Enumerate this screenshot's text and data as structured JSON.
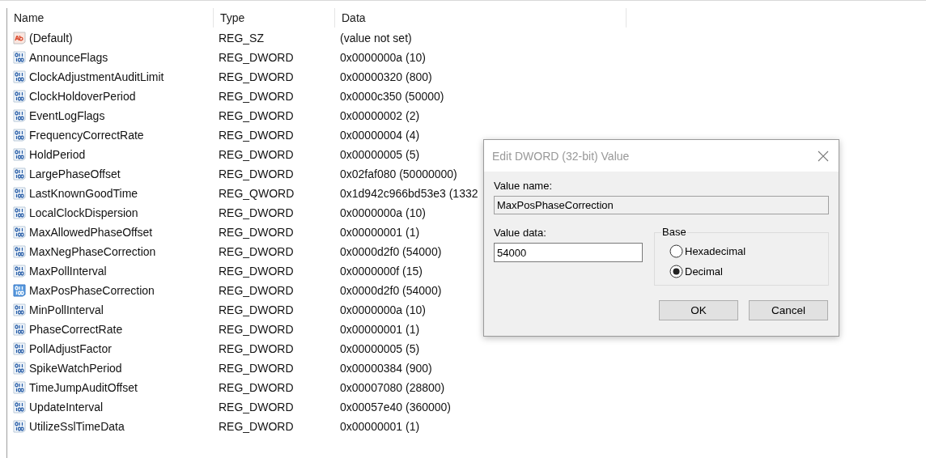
{
  "table": {
    "columns": [
      "Name",
      "Type",
      "Data"
    ],
    "rows": [
      {
        "name": "(Default)",
        "type": "REG_SZ",
        "data": "(value not set)",
        "kind": "string",
        "selected": false
      },
      {
        "name": "AnnounceFlags",
        "type": "REG_DWORD",
        "data": "0x0000000a (10)",
        "kind": "binary",
        "selected": false
      },
      {
        "name": "ClockAdjustmentAuditLimit",
        "type": "REG_DWORD",
        "data": "0x00000320 (800)",
        "kind": "binary",
        "selected": false
      },
      {
        "name": "ClockHoldoverPeriod",
        "type": "REG_DWORD",
        "data": "0x0000c350 (50000)",
        "kind": "binary",
        "selected": false
      },
      {
        "name": "EventLogFlags",
        "type": "REG_DWORD",
        "data": "0x00000002 (2)",
        "kind": "binary",
        "selected": false
      },
      {
        "name": "FrequencyCorrectRate",
        "type": "REG_DWORD",
        "data": "0x00000004 (4)",
        "kind": "binary",
        "selected": false
      },
      {
        "name": "HoldPeriod",
        "type": "REG_DWORD",
        "data": "0x00000005 (5)",
        "kind": "binary",
        "selected": false
      },
      {
        "name": "LargePhaseOffset",
        "type": "REG_DWORD",
        "data": "0x02faf080 (50000000)",
        "kind": "binary",
        "selected": false
      },
      {
        "name": "LastKnownGoodTime",
        "type": "REG_QWORD",
        "data": "0x1d942c966bd53e3 (1332",
        "kind": "binary",
        "selected": false
      },
      {
        "name": "LocalClockDispersion",
        "type": "REG_DWORD",
        "data": "0x0000000a (10)",
        "kind": "binary",
        "selected": false
      },
      {
        "name": "MaxAllowedPhaseOffset",
        "type": "REG_DWORD",
        "data": "0x00000001 (1)",
        "kind": "binary",
        "selected": false
      },
      {
        "name": "MaxNegPhaseCorrection",
        "type": "REG_DWORD",
        "data": "0x0000d2f0 (54000)",
        "kind": "binary",
        "selected": false
      },
      {
        "name": "MaxPollInterval",
        "type": "REG_DWORD",
        "data": "0x0000000f (15)",
        "kind": "binary",
        "selected": false
      },
      {
        "name": "MaxPosPhaseCorrection",
        "type": "REG_DWORD",
        "data": "0x0000d2f0 (54000)",
        "kind": "binary",
        "selected": true
      },
      {
        "name": "MinPollInterval",
        "type": "REG_DWORD",
        "data": "0x0000000a (10)",
        "kind": "binary",
        "selected": false
      },
      {
        "name": "PhaseCorrectRate",
        "type": "REG_DWORD",
        "data": "0x00000001 (1)",
        "kind": "binary",
        "selected": false
      },
      {
        "name": "PollAdjustFactor",
        "type": "REG_DWORD",
        "data": "0x00000005 (5)",
        "kind": "binary",
        "selected": false
      },
      {
        "name": "SpikeWatchPeriod",
        "type": "REG_DWORD",
        "data": "0x00000384 (900)",
        "kind": "binary",
        "selected": false
      },
      {
        "name": "TimeJumpAuditOffset",
        "type": "REG_DWORD",
        "data": "0x00007080 (28800)",
        "kind": "binary",
        "selected": false
      },
      {
        "name": "UpdateInterval",
        "type": "REG_DWORD",
        "data": "0x00057e40 (360000)",
        "kind": "binary",
        "selected": false
      },
      {
        "name": "UtilizeSslTimeData",
        "type": "REG_DWORD",
        "data": "0x00000001 (1)",
        "kind": "binary",
        "selected": false
      }
    ]
  },
  "dialog": {
    "title": "Edit DWORD (32-bit) Value",
    "value_name_label": "Value name:",
    "value_name": "MaxPosPhaseCorrection",
    "value_data_label": "Value data:",
    "value_data": "54000",
    "base_label": "Base",
    "base_options": [
      {
        "label": "Hexadecimal",
        "selected": false
      },
      {
        "label": "Decimal",
        "selected": true
      }
    ],
    "buttons": [
      "OK",
      "Cancel"
    ]
  }
}
